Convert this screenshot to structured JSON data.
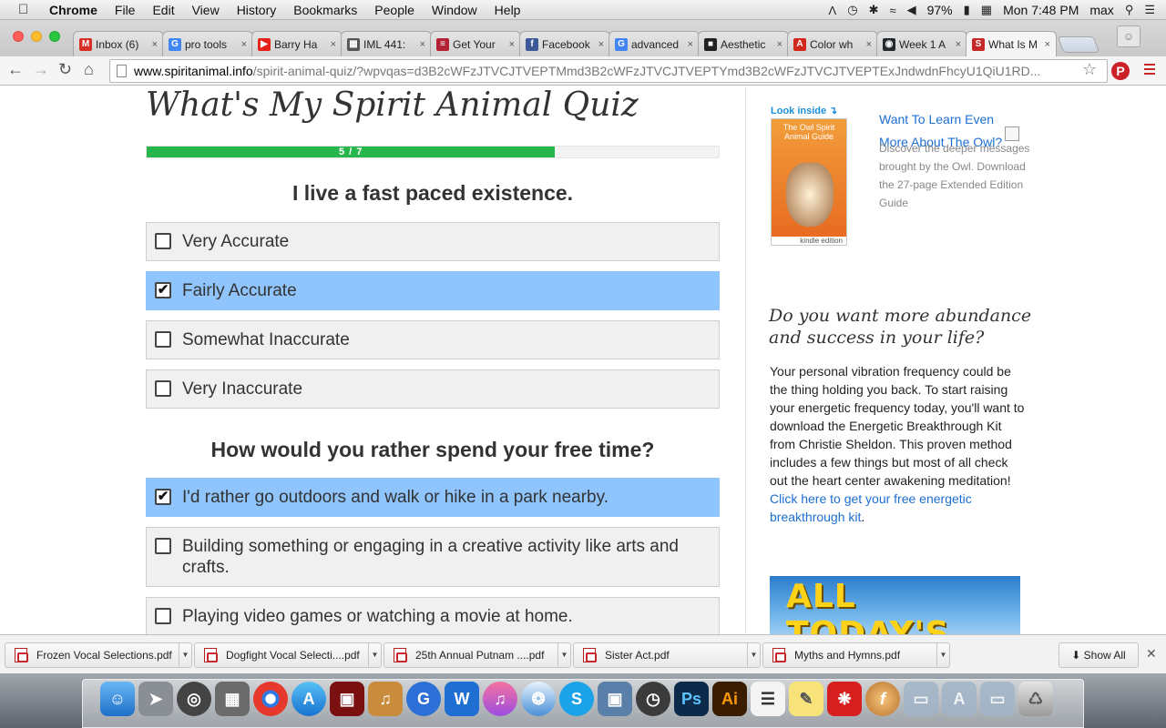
{
  "menubar": {
    "app": "Chrome",
    "items": [
      "File",
      "Edit",
      "View",
      "History",
      "Bookmarks",
      "People",
      "Window",
      "Help"
    ],
    "battery": "97%",
    "clock": "Mon 7:48 PM",
    "user": "max"
  },
  "tabs": [
    {
      "label": "Inbox (6)",
      "color": "#d93025",
      "glyph": "M"
    },
    {
      "label": "pro tools",
      "color": "#4285f4",
      "glyph": "G"
    },
    {
      "label": "Barry Ha",
      "color": "#e62117",
      "glyph": "▶"
    },
    {
      "label": "IML 441:",
      "color": "#555555",
      "glyph": "▦"
    },
    {
      "label": "Get Your",
      "color": "#b22234",
      "glyph": "≡"
    },
    {
      "label": "Facebook",
      "color": "#3b5998",
      "glyph": "f"
    },
    {
      "label": "advanced",
      "color": "#4285f4",
      "glyph": "G"
    },
    {
      "label": "Aesthetic",
      "color": "#222222",
      "glyph": "■"
    },
    {
      "label": "Color wh",
      "color": "#d1261c",
      "glyph": "A"
    },
    {
      "label": "Week 1 A",
      "color": "#24292e",
      "glyph": "◉"
    },
    {
      "label": "What Is M",
      "color": "#c62828",
      "glyph": "S",
      "active": true
    }
  ],
  "address": {
    "host": "www.spiritanimal.info",
    "path": "/spirit-animal-quiz/?wpvqas=d3B2cWFzJTVCJTVEPTMmd3B2cWFzJTVCJTVEPTYmd3B2cWFzJTVCJTVEPTExJndwdnFhcyU1QiU1RD..."
  },
  "quiz": {
    "title": "What's My Spirit Animal Quiz",
    "progress_label": "5 / 7",
    "progress_fraction": 0.714,
    "questions": [
      {
        "text": "I live a fast paced existence.",
        "answers": [
          {
            "label": "Very Accurate",
            "checked": false
          },
          {
            "label": "Fairly Accurate",
            "checked": true
          },
          {
            "label": "Somewhat Inaccurate",
            "checked": false
          },
          {
            "label": "Very Inaccurate",
            "checked": false
          }
        ]
      },
      {
        "text": "How would you rather spend your free time?",
        "answers": [
          {
            "label": "I'd rather go outdoors and walk or hike in a park nearby.",
            "checked": true
          },
          {
            "label": "Building something or engaging in a creative activity like arts and crafts.",
            "checked": false
          },
          {
            "label": "Playing video games or watching a movie at home.",
            "checked": false
          }
        ]
      }
    ]
  },
  "sidebar": {
    "book": {
      "look_inside": "Look inside ↴",
      "cover_title": "The Owl Spirit Animal Guide",
      "edition": "kindle edition"
    },
    "learn_link": "Want To Learn Even More About The Owl?",
    "learn_desc": "Discover the deeper messages brought by the Owl. Download the 27-page Extended Edition Guide",
    "abundance_title": "Do you want more abundance and success in your life?",
    "abundance_body": "Your personal vibration frequency could be the thing holding you back. To start raising your energetic frequency today, you'll want to download the Energetic Breakthrough Kit from Christie Sheldon. This proven method includes a few things but most of all check out the heart center awakening meditation!",
    "abundance_link": "Click here to get your free energetic breakthrough kit",
    "ad_text": "ALL TODAY'S"
  },
  "downloads": {
    "files": [
      "Frozen Vocal Selections.pdf",
      "Dogfight Vocal Selecti....pdf",
      "25th Annual Putnam ....pdf",
      "Sister Act.pdf",
      "Myths and Hymns.pdf"
    ],
    "show_all": "Show All"
  }
}
